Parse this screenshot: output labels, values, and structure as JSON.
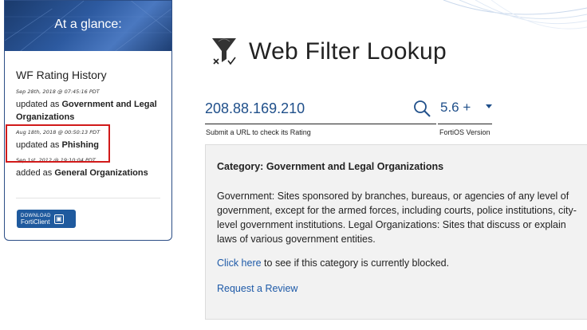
{
  "sidebar": {
    "header_title": "At a glance:",
    "history_title": "WF Rating History",
    "entries": [
      {
        "timestamp": "Sep 28th, 2018 @ 07:45:16 PDT",
        "prefix": "updated as ",
        "category": "Government and Legal Organizations"
      },
      {
        "timestamp": "Aug 18th, 2018 @ 00:50:13 PDT",
        "prefix": "updated as ",
        "category": "Phishing"
      },
      {
        "timestamp": "Sep 1st, 2012 @ 19:10:04 PDT",
        "prefix": "added as ",
        "category": "General Organizations"
      }
    ],
    "download_line1": "DOWNLOAD",
    "download_line2": "FortiClient"
  },
  "main": {
    "title": "Web Filter Lookup",
    "search": {
      "value": "208.88.169.210",
      "hint": "Submit a URL to check its Rating"
    },
    "version": {
      "value": "5.6 +",
      "hint": "FortiOS Version"
    },
    "result": {
      "category_title": "Category: Government and Legal Organizations",
      "description": "Government: Sites sponsored by branches, bureaus, or agencies of any level of government, except for the armed forces, including courts, police institutions, city-level government institutions. Legal Organizations: Sites that discuss or explain laws of various government entities.",
      "click_here": "Click here",
      "blocked_suffix": " to see if this category is currently blocked.",
      "request_review": "Request a Review"
    }
  },
  "colors": {
    "accent": "#1e5aa8",
    "header_blue": "#2d5aa0",
    "highlight": "#d11a1a"
  }
}
